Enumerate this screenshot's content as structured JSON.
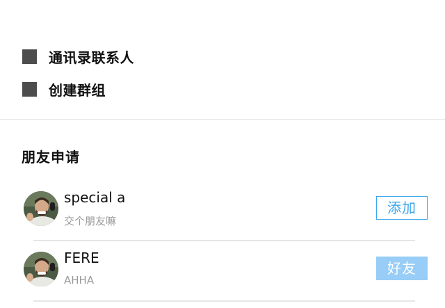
{
  "menu": {
    "items": [
      {
        "label": "通讯录联系人",
        "icon": "contacts-icon"
      },
      {
        "label": "创建群组",
        "icon": "create-group-icon"
      }
    ]
  },
  "friend_requests": {
    "title": "朋友申请",
    "items": [
      {
        "name": "special a",
        "message": "交个朋友嘛",
        "action": "添加",
        "status": "pending"
      },
      {
        "name": "FERE",
        "message": "AHHA",
        "action": "好友",
        "status": "accepted"
      }
    ]
  },
  "colors": {
    "accent": "#3da5ea",
    "accepted_bg": "#97cdf6",
    "icon": "#4d4d4d",
    "secondary_text": "#9a9a9a",
    "divider": "#e2e2e2"
  }
}
